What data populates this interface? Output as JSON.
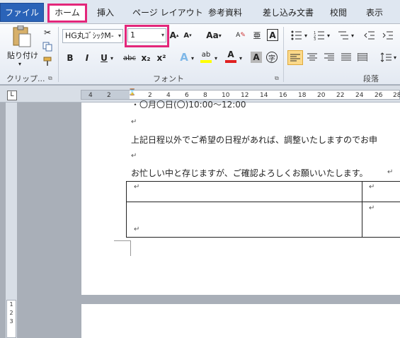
{
  "tabs": {
    "file": "ファイル",
    "home": "ホーム",
    "insert": "挿入",
    "page_layout": "ページ レイアウト",
    "references": "参考資料",
    "mailings": "差し込み文書",
    "review": "校閲",
    "view": "表示"
  },
  "clipboard": {
    "paste_label": "貼り付け",
    "group_label": "クリップ..."
  },
  "font": {
    "font_name": "HG丸ｺﾞｼｯｸM-",
    "font_size": "1",
    "group_label": "フォント",
    "bold": "B",
    "italic": "I",
    "underline": "U",
    "strikethrough": "abc",
    "subscript": "x₂",
    "superscript": "x²",
    "change_case": "Aa",
    "grow": "A",
    "shrink": "A",
    "text_effects": "A",
    "highlight": "ab",
    "font_color": "A",
    "char_shading": "A",
    "clear_format": "A",
    "phonetic": "亜",
    "enclosed": "字",
    "border": "A"
  },
  "paragraph": {
    "group_label": "段落"
  },
  "ruler": {
    "ticks": [
      "4",
      "2",
      "2",
      "4",
      "6",
      "8",
      "10",
      "12",
      "14",
      "16",
      "18",
      "20",
      "22",
      "24",
      "26",
      "28"
    ],
    "vertical": "1 2 3"
  },
  "document": {
    "line_cut": "・〇月〇日(〇)10:00～12:00",
    "line1": "上記日程以外でご希望の日程があれば、調整いたしますのでお申",
    "line2": "お忙しい中と存じますが、ご確認よろしくお願いいたします。",
    "para_mark": "↵"
  },
  "colors": {
    "highlight": "#e3267a",
    "file_tab": "#2a63b8"
  }
}
